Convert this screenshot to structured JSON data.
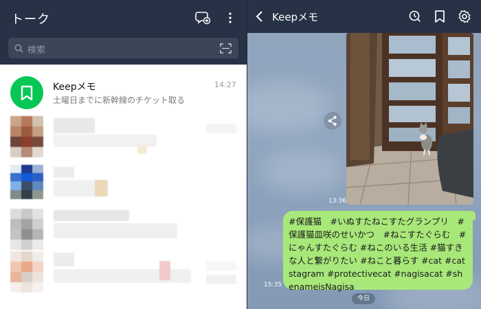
{
  "left": {
    "title": "トーク",
    "search": {
      "placeholder": "検索"
    },
    "chat": {
      "name": "Keepメモ",
      "preview": "土曜日までに新幹線のチケット取る",
      "time": "14:27"
    },
    "icons": [
      "add-chat-icon",
      "more-icon",
      "search-icon",
      "scan-icon",
      "bookmark-icon"
    ]
  },
  "right": {
    "title": "Keepメモ",
    "photo_time": "13:36",
    "message": {
      "text": "#保護猫　#いぬすたねこすたグランプリ　#保護猫皿咲のせいかつ　#ねこすたぐらむ　#にゃんすたぐらむ #ねこのいる生活 #猫すきな人と繋がりたい #ねこと暮らす #cat #catstagram #protectivecat #nagisacat #shenameisNagisa",
      "time": "15:35"
    },
    "date_label": "今日",
    "icons": [
      "back-icon",
      "timer-icon",
      "bookmark-icon",
      "gear-icon",
      "share-icon"
    ]
  },
  "colors": {
    "header_bg": "#273246",
    "keep_green": "#06c755",
    "bubble_green": "#a8e87a"
  }
}
